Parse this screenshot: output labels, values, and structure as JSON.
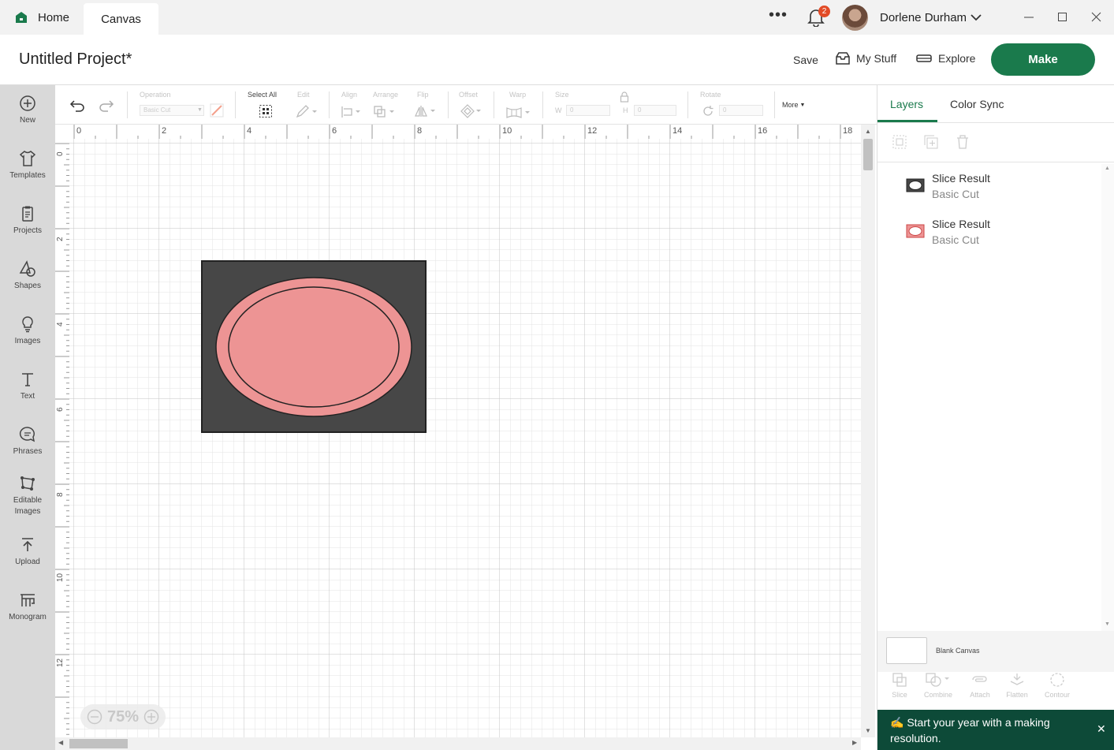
{
  "titlebar": {
    "home_label": "Home",
    "canvas_label": "Canvas",
    "more_icon": "ellipsis-icon",
    "notification_count": "2",
    "user_name": "Dorlene Durham"
  },
  "header": {
    "project_title": "Untitled Project*",
    "save_label": "Save",
    "mystuff_label": "My Stuff",
    "explore_label": "Explore",
    "make_label": "Make",
    "make_color": "#1a7a4c"
  },
  "sidebar": {
    "items": [
      {
        "label": "New",
        "icon": "plus-circle-icon"
      },
      {
        "label": "Templates",
        "icon": "tshirt-icon"
      },
      {
        "label": "Projects",
        "icon": "clipboard-icon"
      },
      {
        "label": "Shapes",
        "icon": "shapes-icon"
      },
      {
        "label": "Images",
        "icon": "lightbulb-icon"
      },
      {
        "label": "Text",
        "icon": "text-icon"
      },
      {
        "label": "Phrases",
        "icon": "chat-icon"
      },
      {
        "label": "Editable Images",
        "icon": "editable-image-icon"
      },
      {
        "label": "Upload",
        "icon": "upload-icon"
      },
      {
        "label": "Monogram",
        "icon": "monogram-icon"
      }
    ]
  },
  "toolbar": {
    "operation_label": "Operation",
    "operation_value": "Basic Cut",
    "select_all_label": "Select All",
    "edit_label": "Edit",
    "align_label": "Align",
    "arrange_label": "Arrange",
    "flip_label": "Flip",
    "offset_label": "Offset",
    "warp_label": "Warp",
    "size_label": "Size",
    "w_label": "W",
    "w_value": "0",
    "h_label": "H",
    "h_value": "0",
    "rotate_label": "Rotate",
    "rotate_value": "0",
    "more_label": "More"
  },
  "canvas": {
    "ruler_top": [
      "0",
      "2",
      "4",
      "6",
      "8",
      "10",
      "12",
      "14",
      "16",
      "18"
    ],
    "ruler_left": [
      "0",
      "2",
      "4",
      "6",
      "8",
      "10",
      "12"
    ],
    "zoom": "75%",
    "shape_colors": {
      "rect": "#474747",
      "ring": "#ed9494",
      "inner": "#ffffff"
    }
  },
  "layers_panel": {
    "tab_layers": "Layers",
    "tab_colorsync": "Color Sync",
    "layers": [
      {
        "name": "Slice Result",
        "type": "Basic Cut",
        "swatch": "#474747"
      },
      {
        "name": "Slice Result",
        "type": "Basic Cut",
        "swatch": "#ed9494"
      }
    ],
    "blank_canvas_label": "Blank Canvas",
    "actions": [
      "Slice",
      "Combine",
      "Attach",
      "Flatten",
      "Contour"
    ],
    "banner_text": "Start your year with a making resolution."
  }
}
